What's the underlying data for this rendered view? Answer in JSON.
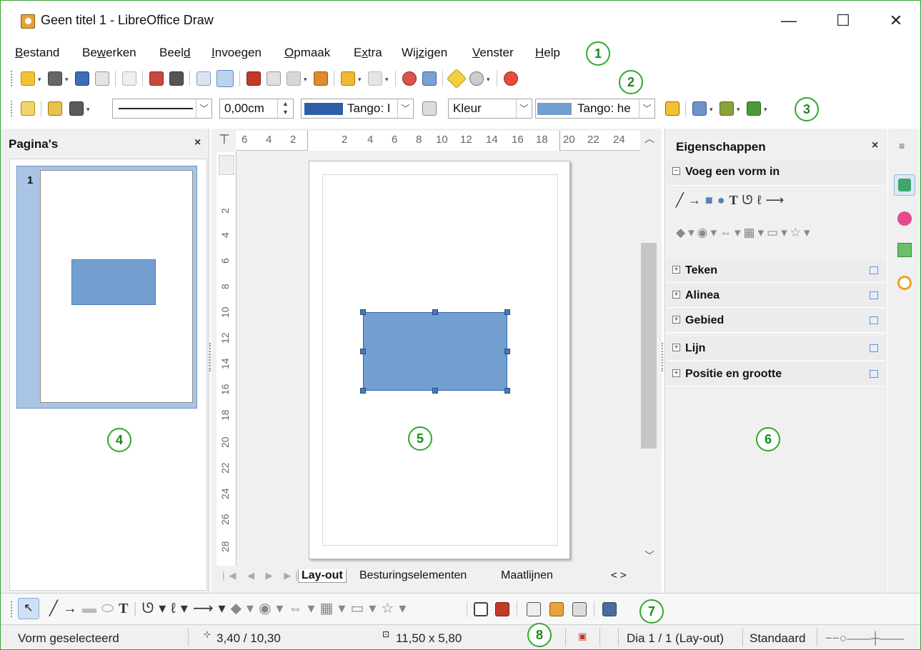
{
  "window": {
    "title": "Geen titel 1 - LibreOffice Draw",
    "minimize": "—",
    "maximize": "☐",
    "close": "✕"
  },
  "menu": [
    {
      "pre": "",
      "u": "B",
      "post": "estand"
    },
    {
      "pre": "Be",
      "u": "w",
      "post": "erken"
    },
    {
      "pre": "Beel",
      "u": "d",
      "post": ""
    },
    {
      "pre": "",
      "u": "I",
      "post": "nvoegen"
    },
    {
      "pre": "",
      "u": "O",
      "post": "pmaak"
    },
    {
      "pre": "E",
      "u": "x",
      "post": "tra"
    },
    {
      "pre": "Wij",
      "u": "z",
      "post": "igen"
    },
    {
      "pre": "",
      "u": "V",
      "post": "enster"
    },
    {
      "pre": "",
      "u": "H",
      "post": "elp"
    }
  ],
  "line_props": {
    "width_value": "0,00cm",
    "line_color_label": "Tango: I",
    "fill_type": "Kleur",
    "fill_color_label": "Tango: he"
  },
  "colors": {
    "line_swatch": "#2f5ea8",
    "fill_swatch": "#729fcf",
    "callout": "#2ea82e"
  },
  "callouts": [
    "1",
    "2",
    "3",
    "4",
    "5",
    "6",
    "7",
    "8"
  ],
  "slides_panel": {
    "title": "Pagina's",
    "close": "×",
    "slide_number": "1"
  },
  "rulers": {
    "h_ticks": [
      "6",
      "4",
      "2",
      "2",
      "4",
      "6",
      "8",
      "10",
      "12",
      "14",
      "16",
      "18",
      "20",
      "22",
      "24"
    ],
    "v_ticks": [
      "2",
      "4",
      "6",
      "8",
      "10",
      "12",
      "14",
      "16",
      "18",
      "20",
      "22",
      "24",
      "26",
      "28"
    ]
  },
  "tabs": [
    "Lay-out",
    "Besturingselementen",
    "Maatlijnen"
  ],
  "tab_nav": "< >",
  "sidebar": {
    "title": "Eigenschappen",
    "close": "×",
    "insert_shape": "Voeg een vorm in",
    "sections": [
      "Teken",
      "Alinea",
      "Gebied",
      "Lijn",
      "Positie en grootte"
    ]
  },
  "status": {
    "selection": "Vorm geselecteerd",
    "position": "3,40 / 10,30",
    "size": "11,50 x 5,80",
    "slide": "Dia 1 / 1 (Lay-out)",
    "layout": "Standaard"
  }
}
